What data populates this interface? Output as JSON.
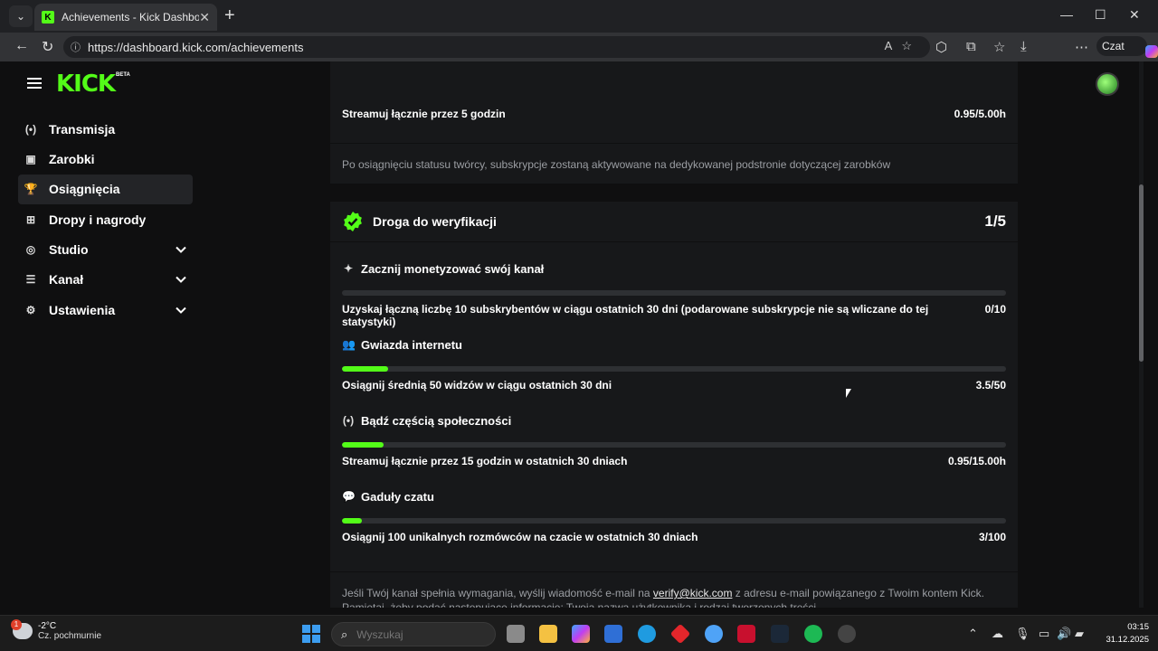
{
  "browser": {
    "tab_title": "Achievements - Kick Dashboard",
    "url": "https://dashboard.kick.com/achievements",
    "copilot_label": "Czat"
  },
  "site": {
    "logo": "KICK",
    "logo_badge": "BETA",
    "nav": [
      {
        "label": "Transmisja",
        "icon": "broadcast-icon",
        "expandable": false,
        "active": false
      },
      {
        "label": "Zarobki",
        "icon": "earnings-icon",
        "expandable": false,
        "active": false
      },
      {
        "label": "Osiągnięcia",
        "icon": "trophy-icon",
        "expandable": false,
        "active": true
      },
      {
        "label": "Dropy i nagrody",
        "icon": "drops-icon",
        "expandable": false,
        "active": false
      },
      {
        "label": "Studio",
        "icon": "studio-icon",
        "expandable": true,
        "active": false
      },
      {
        "label": "Kanał",
        "icon": "channel-icon",
        "expandable": true,
        "active": false
      },
      {
        "label": "Ustawienia",
        "icon": "settings-icon",
        "expandable": true,
        "active": false
      }
    ]
  },
  "top_card": {
    "requirement_label": "Streamuj łącznie przez 5 godzin",
    "requirement_value": "0.95/5.00h",
    "note": "Po osiągnięciu statusu twórcy, subskrypcje zostaną aktywowane na dedykowanej podstronie dotyczącej zarobków"
  },
  "verification": {
    "title": "Droga do weryfikacji",
    "count": "1/5",
    "tasks": [
      {
        "title": "Zacznij monetyzować swój kanał",
        "icon": "sparkle-icon",
        "desc": "Uzyskaj łączną liczbę 10 subskrybentów w ciągu ostatnich 30 dni (podarowane subskrypcje nie są wliczane do tej statystyki)",
        "value": "0/10",
        "progress": 0
      },
      {
        "title": "Gwiazda internetu",
        "icon": "users-icon",
        "desc": "Osiągnij średnią 50 widzów w ciągu ostatnich 30 dni",
        "value": "3.5/50",
        "progress": 0.07
      },
      {
        "title": "Bądź częścią społeczności",
        "icon": "broadcast-icon",
        "desc": "Streamuj łącznie przez 15 godzin w ostatnich 30 dniach",
        "value": "0.95/15.00h",
        "progress": 0.063
      },
      {
        "title": "Gaduły czatu",
        "icon": "chat-icon",
        "desc": "Osiągnij 100 unikalnych rozmówców na czacie w ostatnich 30 dniach",
        "value": "3/100",
        "progress": 0.03
      }
    ],
    "footnote_pre": "Jeśli Twój kanał spełnia wymagania, wyślij wiadomość e-mail na ",
    "footnote_email": "verify@kick.com",
    "footnote_post": " z adresu e-mail powiązanego z Twoim kontem Kick. Pamiętaj, żeby podać następujące informacje: Twoja nazwa użytkownika i rodzaj tworzonych treści."
  },
  "taskbar": {
    "weather_temp": "-2°C",
    "weather_desc": "Cz. pochmurnie",
    "weather_badge": "1",
    "search_placeholder": "Wyszukaj",
    "time": "03:15",
    "date": "31.12.2025"
  }
}
